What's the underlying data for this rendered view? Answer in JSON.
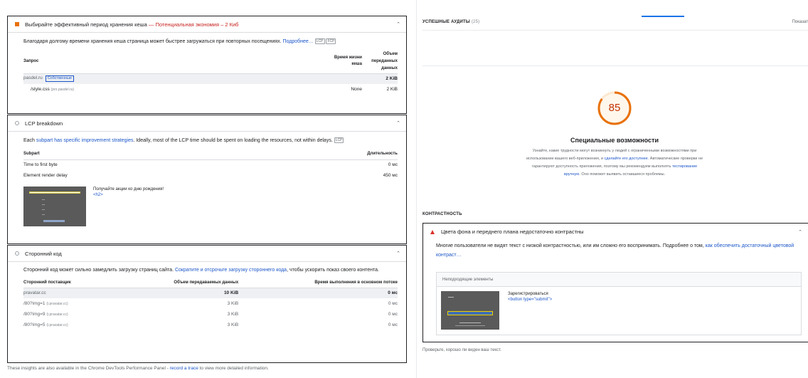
{
  "cache_audit": {
    "title": "Выбирайте эффективный период хранения кеша",
    "savings": " — Потенциальная экономия – 2 Киб",
    "description": "Благодаря долгому времени хранения кеша страница может быстрее загружаться при повторных посещениях.",
    "more_link": "Подробнее…",
    "chips": [
      "LCP",
      "FCP"
    ],
    "col_request": "Запрос",
    "col_ttl": "Время жизни кеша",
    "col_size": "Объем переданных данных",
    "group": {
      "name": "pasdel.ru",
      "badge": "Собственные",
      "size": "2 KiB"
    },
    "rows": [
      {
        "url": "/style.css",
        "host": "(pro.pasdel.ru)",
        "ttl": "None",
        "size": "2 KiB"
      }
    ],
    "accent_color": "#e8710a"
  },
  "lcp_audit": {
    "title": "LCP breakdown",
    "desc_pre": "Each ",
    "desc_link": "subpart has specific improvement strategies",
    "desc_post": ". Ideally, most of the LCP time should be spent on loading the resources, not within delays.",
    "chip": "LCP",
    "col_subpart": "Subpart",
    "col_duration": "Длительность",
    "rows": [
      {
        "name": "Time to first byte",
        "value": "0 мс"
      },
      {
        "name": "Element render delay",
        "value": "450 мс"
      }
    ],
    "node_text": "Получайте акции ко дню рождения!",
    "node_tag": "<h2>"
  },
  "third_party_audit": {
    "title": "Сторонний код",
    "desc_pre": "Сторонний код может сильно замедлить загрузку страниц сайта. ",
    "desc_link": "Сократите и отсрочьте загрузку стороннего кода",
    "desc_post": ", чтобы ускорить показ своего контента.",
    "col_vendor": "Сторонний поставщик",
    "col_transfer": "Объем передаваемых данных",
    "col_main": "Время выполнения в основном потоке",
    "group": {
      "name": "pravatar.cc",
      "transfer": "10 KiB",
      "main": "0 мс"
    },
    "rows": [
      {
        "url": "/80?img=1",
        "host": "(i.pravatar.cc)",
        "transfer": "3 KiB",
        "main": "0 мс"
      },
      {
        "url": "/80?img=9",
        "host": "(i.pravatar.cc)",
        "transfer": "3 KiB",
        "main": "0 мс"
      },
      {
        "url": "/80?img=5",
        "host": "(i.pravatar.cc)",
        "transfer": "3 KiB",
        "main": "0 мс"
      }
    ]
  },
  "footnote": {
    "pre": "These insights are also available in the Chrome DevTools Performance Panel - ",
    "link": "record a trace",
    "post": " to view more detailed information."
  },
  "right": {
    "passed_label": "УСПЕШНЫЕ АУДИТЫ",
    "passed_count": "(25)",
    "show_label": "Показат",
    "score": "85",
    "score_fraction": 0.85,
    "score_color": "#e8710a",
    "category_title": "Специальные возможности",
    "desc1": "Узнайте, какие трудности могут возникнуть у людей с ограниченными возможностями при использовании вашего веб-приложения, и ",
    "desc_link1": "сделайте его доступнее",
    "desc2": ". Автоматические проверки не гарантируют доступность приложения, поэтому мы рекомендуем выполнять ",
    "desc_link2": "тестирование вручную",
    "desc3": ". Оно поможет выявить оставшиеся проблемы.",
    "group_label": "КОНТРАСТНОСТЬ",
    "audit_title": "Цвета фона и переднего плана недостаточно контрастны",
    "audit_desc_pre": "Многие пользователи не видят текст с низкой контрастностью, или им сложно его воспринимать. Подробнее о том, ",
    "audit_desc_link": "как обеспечить достаточный цветовой контраст…",
    "elements_header": "Неподходящие элементы",
    "element_text": "Зарегистрироваться",
    "element_code": "<button type=\"submit\">",
    "footer": "Проверьте, хорошо ли виден ваш текст."
  }
}
